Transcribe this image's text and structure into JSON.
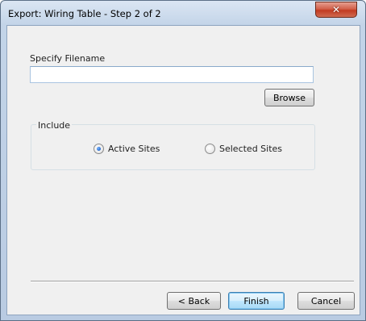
{
  "window": {
    "title": "Export: Wiring Table - Step 2 of 2",
    "close_glyph": "✕"
  },
  "filename": {
    "label": "Specify Filename",
    "value": "",
    "placeholder": ""
  },
  "browse_label": "Browse",
  "include": {
    "title": "Include",
    "options": [
      {
        "label": "Active Sites",
        "checked": true
      },
      {
        "label": "Selected Sites",
        "checked": false
      }
    ]
  },
  "buttons": {
    "back": "< Back",
    "finish": "Finish",
    "cancel": "Cancel"
  },
  "colors": {
    "close_button": "#c7402a",
    "default_button_border": "#3c7fb1",
    "frame": "#b9cbe2"
  }
}
